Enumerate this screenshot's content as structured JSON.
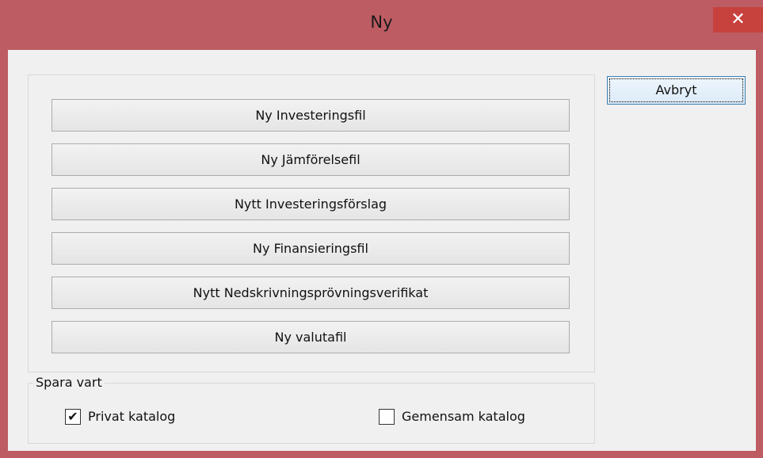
{
  "window": {
    "title": "Ny",
    "close_glyph": "✕",
    "colors": {
      "titlebar": "#bd5c63",
      "close_button": "#c7413d",
      "client": "#f0f0f0"
    }
  },
  "buttons": [
    {
      "label": "Ny Investeringsfil"
    },
    {
      "label": "Ny Jämförelsefil"
    },
    {
      "label": "Nytt Investeringsförslag"
    },
    {
      "label": "Ny Finansieringsfil"
    },
    {
      "label": "Nytt Nedskrivningsprövningsverifikat"
    },
    {
      "label": "Ny valutafil"
    }
  ],
  "cancel_button": {
    "label": "Avbryt"
  },
  "save_location": {
    "group_label": "Spara vart",
    "options": [
      {
        "label": "Privat katalog",
        "checked": true,
        "check_glyph": "✔"
      },
      {
        "label": "Gemensam katalog",
        "checked": false,
        "check_glyph": ""
      }
    ]
  }
}
